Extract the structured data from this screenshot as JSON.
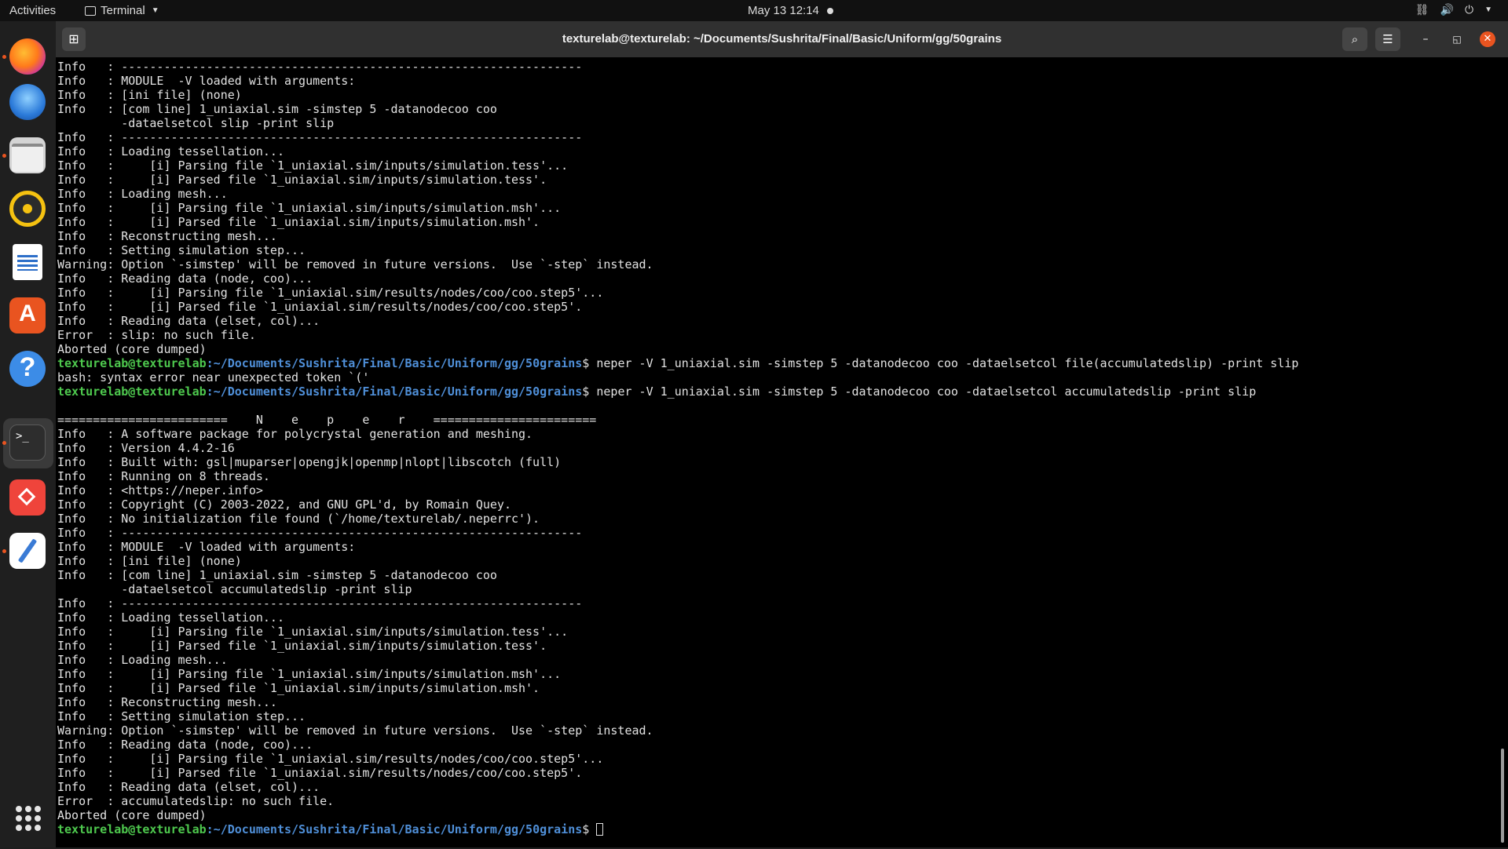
{
  "topbar": {
    "activities": "Activities",
    "app_name": "Terminal",
    "clock": "May 13  12:14"
  },
  "dock": {
    "items": [
      "firefox",
      "thunderbird",
      "files",
      "rhythmbox",
      "libreoffice-writer",
      "app-center",
      "help",
      "terminal",
      "anydesk",
      "text-editor"
    ],
    "show_apps_icon": "grid-icon",
    "running_indicator_color": "#e95420"
  },
  "window": {
    "title": "texturelab@texturelab: ~/Documents/Sushrita/Final/Basic/Uniform/gg/50grains",
    "icons": {
      "new_tab": "new-tab-icon",
      "search": "search-icon",
      "menu": "hamburger-menu-icon",
      "minimize": "minimize-icon",
      "maximize": "maximize-icon",
      "close": "close-icon"
    }
  },
  "terminal": {
    "prompt": {
      "user_host": "texturelab@texturelab",
      "path": ":~/Documents/Sushrita/Final/Basic/Uniform/gg/50grains",
      "symbol": "$ "
    },
    "colors": {
      "prompt_user": "#4ec94e",
      "prompt_path": "#4f8fd8",
      "text": "#e2e2e2",
      "background": "#000000"
    },
    "lines": [
      {
        "text": "Info   : -----------------------------------------------------------------"
      },
      {
        "text": "Info   : MODULE  -V loaded with arguments:"
      },
      {
        "text": "Info   : [ini file] (none)"
      },
      {
        "text": "Info   : [com line] 1_uniaxial.sim -simstep 5 -datanodecoo coo"
      },
      {
        "text": "         -dataelsetcol slip -print slip"
      },
      {
        "text": "Info   : -----------------------------------------------------------------"
      },
      {
        "text": "Info   : Loading tessellation..."
      },
      {
        "text": "Info   :     [i] Parsing file `1_uniaxial.sim/inputs/simulation.tess'..."
      },
      {
        "text": "Info   :     [i] Parsed file `1_uniaxial.sim/inputs/simulation.tess'."
      },
      {
        "text": "Info   : Loading mesh..."
      },
      {
        "text": "Info   :     [i] Parsing file `1_uniaxial.sim/inputs/simulation.msh'..."
      },
      {
        "text": "Info   :     [i] Parsed file `1_uniaxial.sim/inputs/simulation.msh'."
      },
      {
        "text": "Info   : Reconstructing mesh..."
      },
      {
        "text": "Info   : Setting simulation step..."
      },
      {
        "text": "Warning: Option `-simstep' will be removed in future versions.  Use `-step` instead."
      },
      {
        "text": "Info   : Reading data (node, coo)..."
      },
      {
        "text": "Info   :     [i] Parsing file `1_uniaxial.sim/results/nodes/coo/coo.step5'..."
      },
      {
        "text": "Info   :     [i] Parsed file `1_uniaxial.sim/results/nodes/coo/coo.step5'."
      },
      {
        "text": "Info   : Reading data (elset, col)..."
      },
      {
        "text": "Error  : slip: no such file."
      },
      {
        "text": "Aborted (core dumped)"
      },
      {
        "prompt": true,
        "text": "neper -V 1_uniaxial.sim -simstep 5 -datanodecoo coo -dataelsetcol file(accumulatedslip) -print slip"
      },
      {
        "text": "bash: syntax error near unexpected token `('"
      },
      {
        "prompt": true,
        "text": "neper -V 1_uniaxial.sim -simstep 5 -datanodecoo coo -dataelsetcol accumulatedslip -print slip"
      },
      {
        "text": ""
      },
      {
        "text": "========================    N    e    p    e    r    ======================="
      },
      {
        "text": "Info   : A software package for polycrystal generation and meshing."
      },
      {
        "text": "Info   : Version 4.4.2-16"
      },
      {
        "text": "Info   : Built with: gsl|muparser|opengjk|openmp|nlopt|libscotch (full)"
      },
      {
        "text": "Info   : Running on 8 threads."
      },
      {
        "text": "Info   : <https://neper.info>"
      },
      {
        "text": "Info   : Copyright (C) 2003-2022, and GNU GPL'd, by Romain Quey."
      },
      {
        "text": "Info   : No initialization file found (`/home/texturelab/.neperrc')."
      },
      {
        "text": "Info   : -----------------------------------------------------------------"
      },
      {
        "text": "Info   : MODULE  -V loaded with arguments:"
      },
      {
        "text": "Info   : [ini file] (none)"
      },
      {
        "text": "Info   : [com line] 1_uniaxial.sim -simstep 5 -datanodecoo coo"
      },
      {
        "text": "         -dataelsetcol accumulatedslip -print slip"
      },
      {
        "text": "Info   : -----------------------------------------------------------------"
      },
      {
        "text": "Info   : Loading tessellation..."
      },
      {
        "text": "Info   :     [i] Parsing file `1_uniaxial.sim/inputs/simulation.tess'..."
      },
      {
        "text": "Info   :     [i] Parsed file `1_uniaxial.sim/inputs/simulation.tess'."
      },
      {
        "text": "Info   : Loading mesh..."
      },
      {
        "text": "Info   :     [i] Parsing file `1_uniaxial.sim/inputs/simulation.msh'..."
      },
      {
        "text": "Info   :     [i] Parsed file `1_uniaxial.sim/inputs/simulation.msh'."
      },
      {
        "text": "Info   : Reconstructing mesh..."
      },
      {
        "text": "Info   : Setting simulation step..."
      },
      {
        "text": "Warning: Option `-simstep' will be removed in future versions.  Use `-step` instead."
      },
      {
        "text": "Info   : Reading data (node, coo)..."
      },
      {
        "text": "Info   :     [i] Parsing file `1_uniaxial.sim/results/nodes/coo/coo.step5'..."
      },
      {
        "text": "Info   :     [i] Parsed file `1_uniaxial.sim/results/nodes/coo/coo.step5'."
      },
      {
        "text": "Info   : Reading data (elset, col)..."
      },
      {
        "text": "Error  : accumulatedslip: no such file."
      },
      {
        "text": "Aborted (core dumped)"
      },
      {
        "prompt": true,
        "cursor": true,
        "text": ""
      }
    ]
  }
}
